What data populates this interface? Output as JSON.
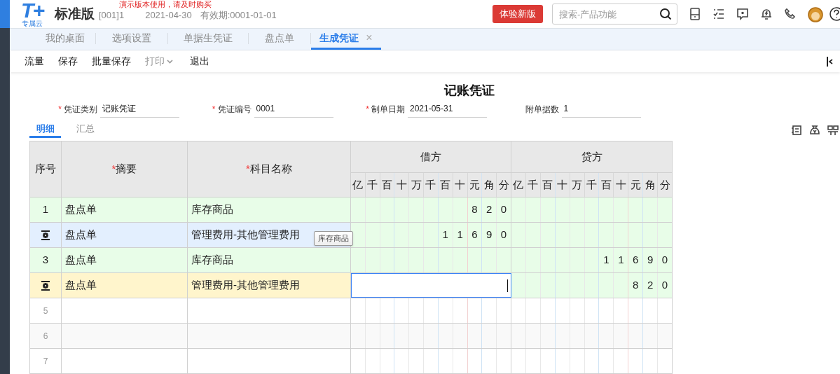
{
  "header": {
    "logo": "T+",
    "logo_sub": "专属云",
    "edition": "标准版",
    "notice": "演示版本使用，请及时购买",
    "account": "[001]1",
    "date": "2021-04-30",
    "validity": "有效期:0001-01-01",
    "try_button": "体验新版",
    "search": {
      "placeholder": "搜索-产品功能"
    }
  },
  "tabs": [
    {
      "label": "我的桌面",
      "selected": false
    },
    {
      "label": "选项设置",
      "selected": false
    },
    {
      "label": "单据生凭证",
      "selected": false
    },
    {
      "label": "盘点单",
      "selected": false
    },
    {
      "label": "生成凭证",
      "selected": true,
      "close": "×"
    }
  ],
  "toolbar": [
    {
      "label": "流量",
      "disabled": false
    },
    {
      "label": "保存",
      "disabled": false
    },
    {
      "label": "批量保存",
      "disabled": false
    },
    {
      "label": "打印",
      "disabled": true,
      "dropdown": true
    },
    {
      "label": "退出",
      "disabled": false
    }
  ],
  "voucher": {
    "title": "记账凭证",
    "fields": [
      {
        "mark": "*",
        "label": "凭证类别",
        "value": "记账凭证"
      },
      {
        "mark": "*",
        "label": "凭证编号",
        "value": "0001"
      },
      {
        "mark": "*",
        "label": "制单日期",
        "value": "2021-05-31"
      },
      {
        "label": "附单据数",
        "value": "1"
      }
    ],
    "subtabs": [
      {
        "label": "明细",
        "selected": true
      },
      {
        "label": "汇总",
        "selected": false
      }
    ],
    "table": {
      "columns": [
        {
          "label": "序号"
        },
        {
          "mark": "*",
          "label": "摘要"
        },
        {
          "mark": "*",
          "label": "科目名称"
        }
      ],
      "debit": "借方",
      "credit": "贷方",
      "debit_units": [
        "亿",
        "千",
        "百",
        "十",
        "万",
        "千",
        "百",
        "十",
        "元",
        "角",
        "分"
      ],
      "credit_units": [
        "亿",
        "千",
        "百",
        "十",
        "万",
        "千",
        "百",
        "十",
        "元",
        "角",
        "分"
      ],
      "rows": [
        {
          "seq": "1",
          "summary": "盘点单",
          "account": "库存商品",
          "debit": [
            "8",
            "2",
            "0"
          ],
          "hovered": false,
          "selected": false
        },
        {
          "summary": "盘点单",
          "account": "管理费用-其他管理费用",
          "debit": [
            "1",
            "1",
            "6",
            "9",
            "0"
          ],
          "hovered": true,
          "selected": false,
          "tooltip": "库存商品"
        },
        {
          "seq": "3",
          "summary": "盘点单",
          "account": "库存商品",
          "credit": [
            "1",
            "1",
            "6",
            "9",
            "0"
          ],
          "hovered": false,
          "selected": false
        },
        {
          "summary": "盘点单",
          "account": "管理费用-其他管理费用",
          "credit": [
            "8",
            "2",
            "0"
          ],
          "hovered": false,
          "selected": true
        },
        {
          "seq": "5",
          "hovered": false,
          "selected": false
        },
        {
          "seq": "6",
          "hovered": false,
          "selected": false
        },
        {
          "seq": "7",
          "hovered": false,
          "selected": false
        }
      ]
    }
  }
}
